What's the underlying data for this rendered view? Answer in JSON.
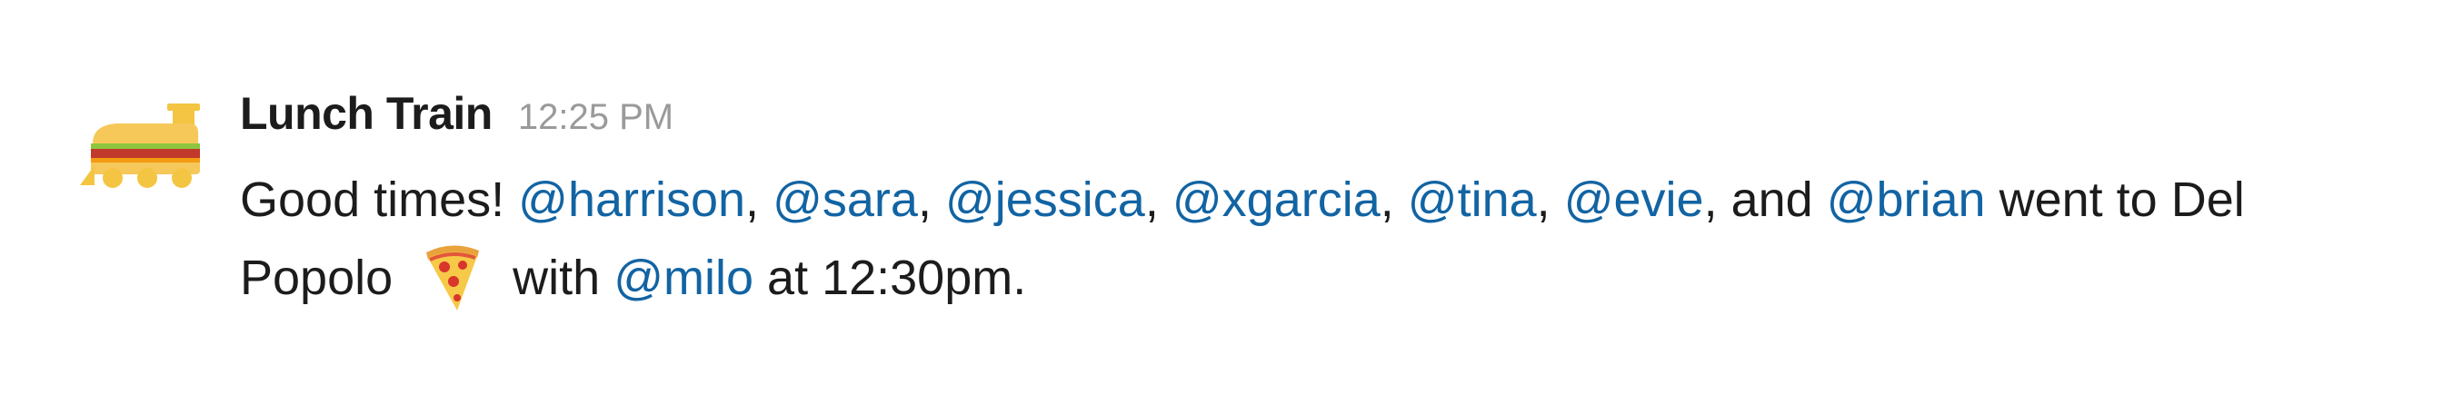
{
  "message": {
    "sender": "Lunch Train",
    "timestamp": "12:25 PM",
    "avatar_icon": "train-sandwich-icon",
    "text_parts": {
      "intro": "Good times! ",
      "sep": ", ",
      "and": ", and ",
      "went_to": " went to Del",
      "place_end": "Popolo ",
      "with": " with ",
      "at_time": " at 12:30pm."
    },
    "mentions": [
      "@harrison",
      "@sara",
      "@jessica",
      "@xgarcia",
      "@tina",
      "@evie",
      "@brian"
    ],
    "host_mention": "@milo",
    "emoji": "pizza-icon",
    "colors": {
      "mention": "#1264a3",
      "text": "#1d1c1d",
      "timestamp": "#9a9a9a",
      "avatar": "#f4c542"
    }
  }
}
